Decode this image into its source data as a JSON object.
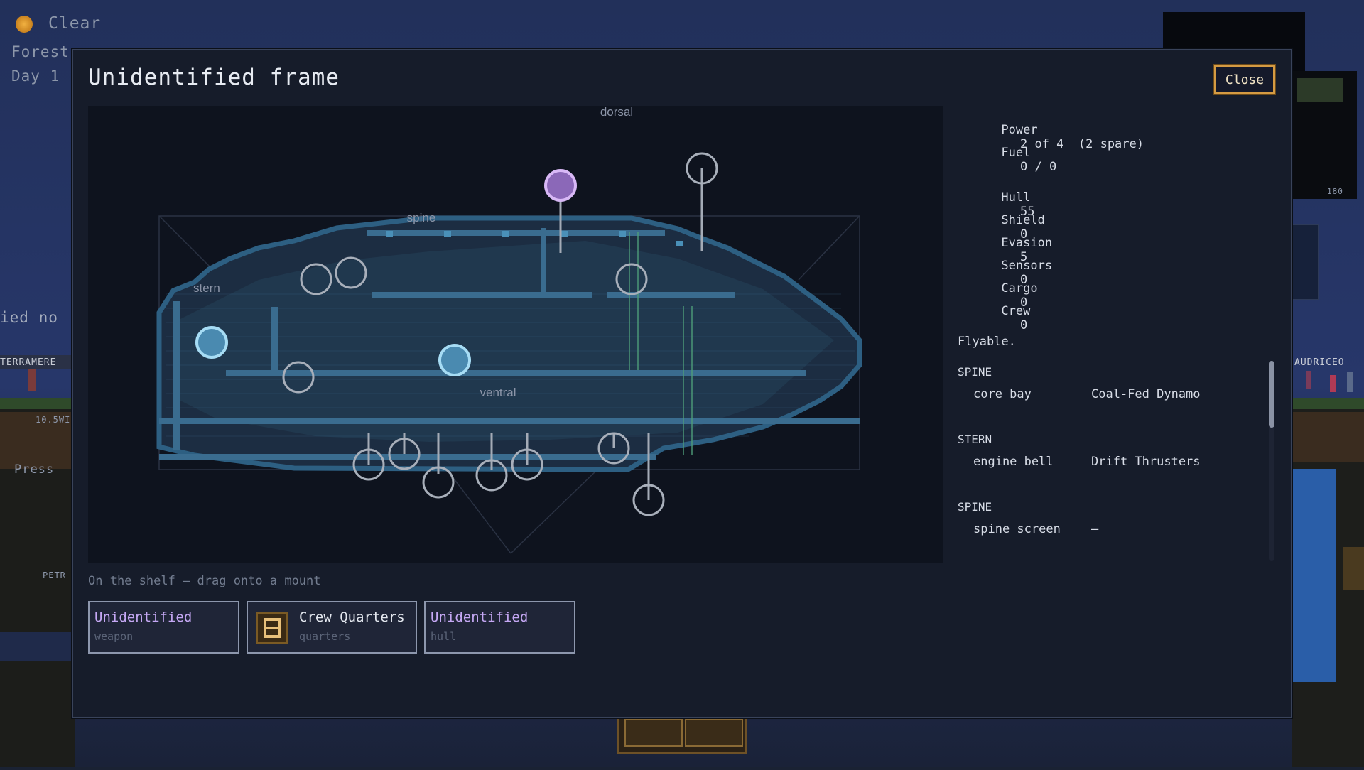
{
  "hud": {
    "weather": "Clear",
    "biome": "Forest",
    "day": "Day 1",
    "side_text": "ied no",
    "hint_text": "Press",
    "sign_text": "TERRAMERE",
    "sign_text_right": "AUDRICEO",
    "small_label": "10.5WI",
    "small_label_2": "PETR",
    "minimap_value": "180"
  },
  "modal": {
    "title": "Unidentified frame",
    "close_label": "Close"
  },
  "ship_view": {
    "labels": {
      "dorsal": "dorsal",
      "spine": "spine",
      "stern": "stern",
      "ventral": "ventral"
    }
  },
  "stats": {
    "power_label": "Power",
    "power_value": "2 of 4  (2 spare)",
    "fuel_label": "Fuel",
    "fuel_value": "0 / 0",
    "hull_label": "Hull",
    "hull_value": "55",
    "shield_label": "Shield",
    "shield_value": "0",
    "evasion_label": "Evasion",
    "evasion_value": "5",
    "sensors_label": "Sensors",
    "sensors_value": "0",
    "cargo_label": "Cargo",
    "cargo_value": "0",
    "crew_label": "Crew",
    "crew_value": "0",
    "flyable_text": "Flyable."
  },
  "sections": [
    {
      "title": "SPINE",
      "slot": "core bay",
      "part": "Coal-Fed Dynamo"
    },
    {
      "title": "STERN",
      "slot": "engine bell",
      "part": "Drift Thrusters"
    },
    {
      "title": "SPINE",
      "slot": "spine screen",
      "part": "–"
    }
  ],
  "shelf": {
    "label": "On the shelf – drag onto a mount",
    "cards": [
      {
        "name": "Unidentified",
        "kind": "weapon"
      },
      {
        "name": "Crew Quarters",
        "kind": "quarters"
      },
      {
        "name": "Unidentified",
        "kind": "hull"
      }
    ]
  },
  "colors": {
    "accent": "#d59b43",
    "unidentified": "#c5a8f4",
    "mount_active": "#8fd3f0",
    "mount_selected": "#c9a6ee",
    "mount_empty": "#9aa1ad"
  }
}
